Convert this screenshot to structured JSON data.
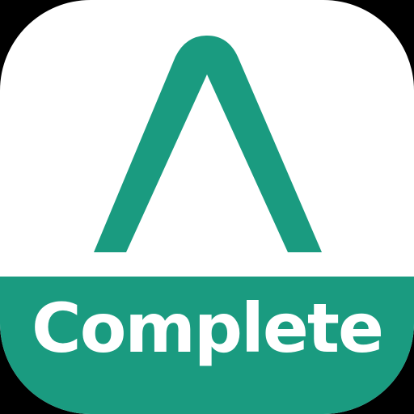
{
  "app_icon": {
    "mark_icon": "caret-a-icon",
    "label": "Complete",
    "colors": {
      "brand_green": "#1a9b80",
      "background": "#ffffff",
      "label_text": "#ffffff",
      "outer": "#000000"
    }
  }
}
